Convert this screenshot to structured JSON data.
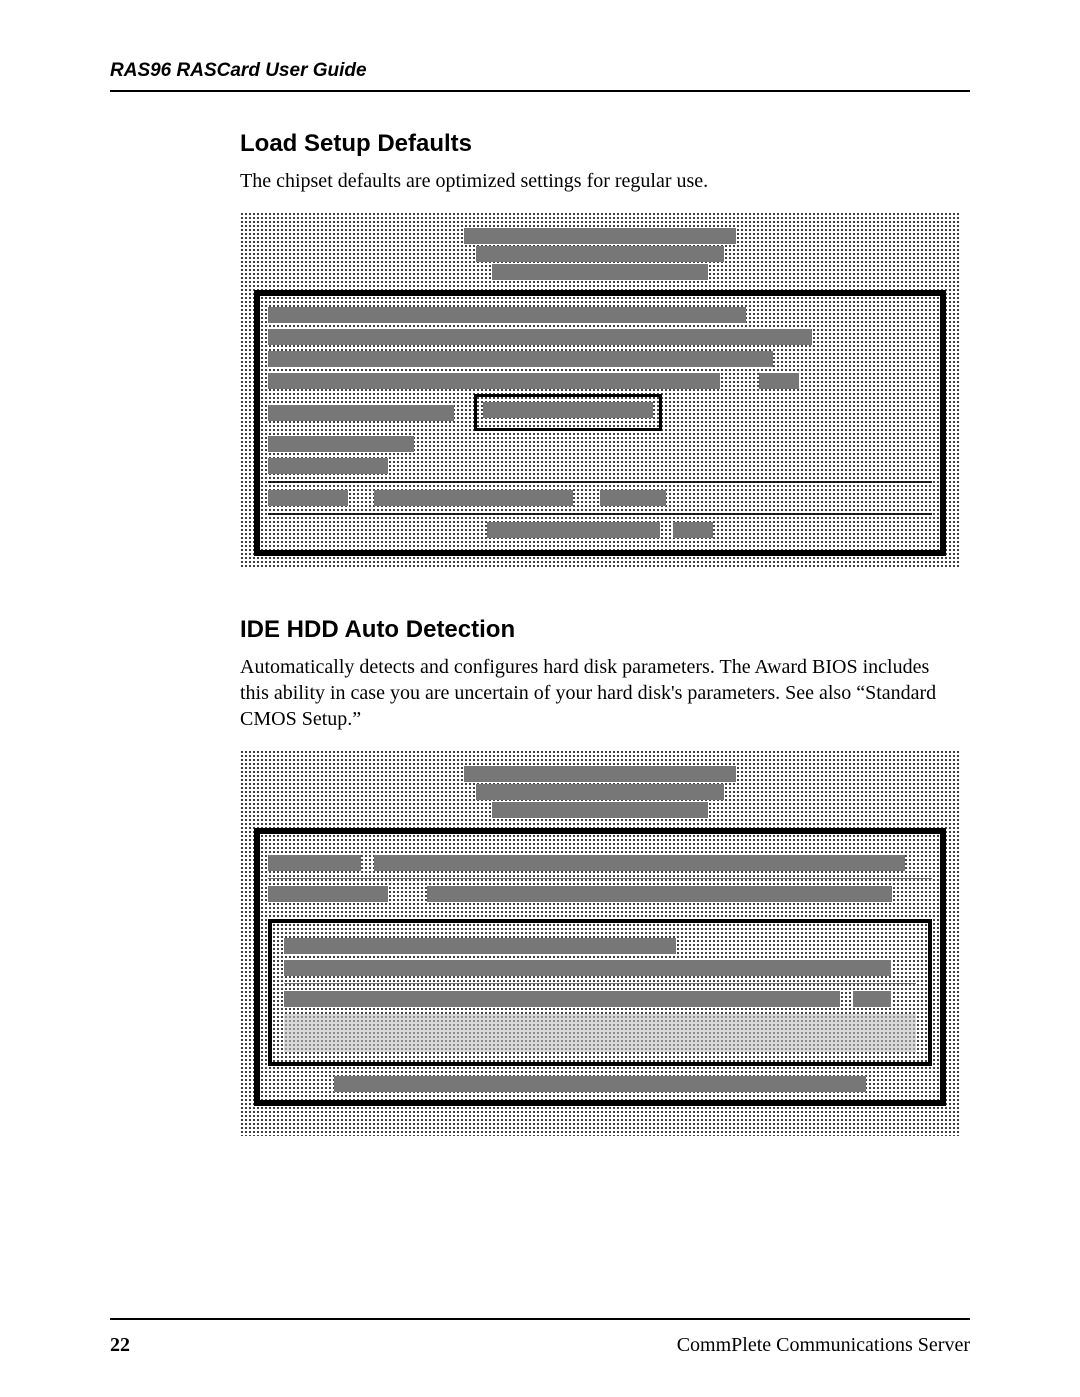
{
  "header": {
    "title": "RAS96 RASCard User Guide"
  },
  "sections": {
    "load_defaults": {
      "title": "Load Setup Defaults",
      "body": "The chipset defaults are optimized settings for regular use."
    },
    "ide_hdd": {
      "title": "IDE HDD Auto Detection",
      "body": "Automatically detects and configures hard disk parameters. The Award BIOS includes this ability in case you are uncertain of your hard disk's parameters. See also “Standard CMOS Setup.”"
    }
  },
  "footer": {
    "page": "22",
    "product": "CommPlete Communications Server"
  }
}
